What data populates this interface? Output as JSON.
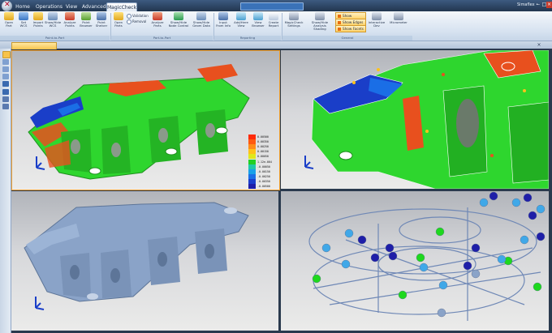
{
  "window": {
    "title_right": "Simaflex •",
    "controls": [
      "–",
      "□",
      "×"
    ]
  },
  "tabs": [
    {
      "label": "Home",
      "active": false
    },
    {
      "label": "Operations",
      "active": false
    },
    {
      "label": "View",
      "active": false
    },
    {
      "label": "Advanced",
      "active": false
    },
    {
      "label": "MagicCheck",
      "active": true
    }
  ],
  "ribbon": {
    "buttons": [
      {
        "label": "Open\nPart"
      },
      {
        "label": "Set\nWCS"
      },
      {
        "label": "Import\nPoints"
      },
      {
        "label": "Show/Hide\nWCS"
      },
      {
        "label": "Analyze\nPoints"
      },
      {
        "label": "Point\nBrowser"
      },
      {
        "label": "Point\nShelver"
      },
      {
        "label": "Open\nParts"
      },
      {
        "label": "Analyze\nParts"
      },
      {
        "label": "Show/Hide\nNode Control"
      },
      {
        "label": "Show/Hide\nGeom Data"
      },
      {
        "label": "Input\nFrom Info"
      },
      {
        "label": "Add/Here\nView"
      },
      {
        "label": "View\nBrowser"
      },
      {
        "label": "Create\nReport"
      },
      {
        "label": "MagicCheck\nSettings"
      },
      {
        "label": "Show/Hide\nAnalysis Shading"
      },
      {
        "label": "Interactive\nDev"
      },
      {
        "label": "Micrometer\n"
      }
    ],
    "checks": [
      "Validation",
      "Removal"
    ],
    "options": [
      "Show Outlines",
      "Show Edges",
      "Show Facets"
    ],
    "groups": [
      "Point-to-Part",
      "Part-to-Part",
      "Reporting",
      "General"
    ]
  },
  "legend": {
    "values": [
      "0.00500",
      "0.00350",
      "0.00250",
      "0.00150",
      "0.00050",
      "1.12e-004",
      "-0.00050",
      "-0.00150",
      "-0.00250",
      "-0.00350",
      "-0.00500"
    ],
    "colors": [
      "#ff2a0a",
      "#ff5a10",
      "#ff8c18",
      "#ffc21a",
      "#e0e81c",
      "#22d024",
      "#20c8a8",
      "#18a0e8",
      "#1a6ee6",
      "#1a3ecc",
      "#1e1ea8"
    ]
  },
  "theme": {
    "deviation_green": "#2ed62e",
    "deviation_red": "#e8501e",
    "deviation_blue": "#1a3ec8",
    "mesh_blue": "#8aa3c8",
    "accent_orange": "#f2a02c"
  }
}
